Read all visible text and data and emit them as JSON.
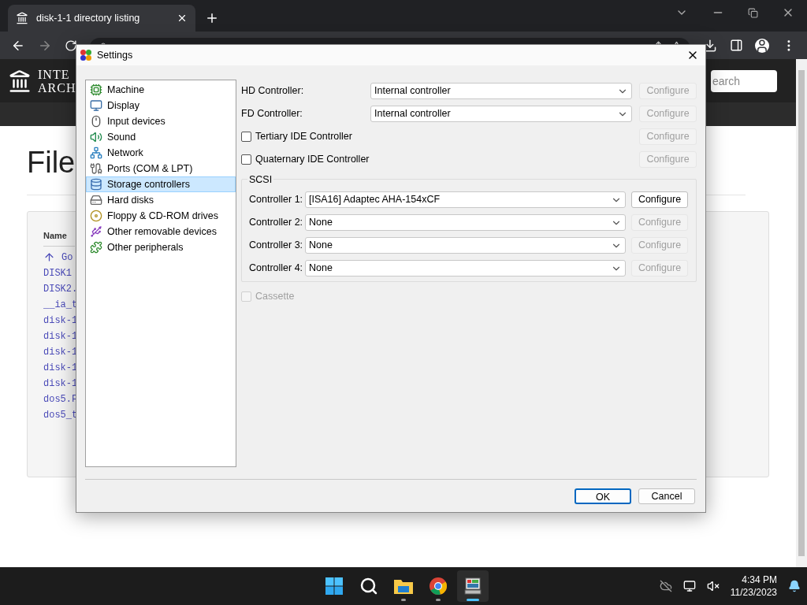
{
  "browser": {
    "tab": {
      "title": "disk-1-1 directory listing"
    }
  },
  "page": {
    "logo_lines": [
      "INTE",
      "ARCH"
    ],
    "search": {
      "placeholder": "earch"
    },
    "heading": "File",
    "table": {
      "column": "Name",
      "rows": [
        "Go",
        "DISK1",
        "DISK2.",
        "__ia_t",
        "disk-1",
        "disk-1",
        "disk-1",
        "disk-1",
        "disk-1",
        "dos5.F",
        "dos5_t"
      ]
    }
  },
  "dialog": {
    "title": "Settings",
    "categories": [
      {
        "label": "Machine",
        "selected": false
      },
      {
        "label": "Display",
        "selected": false
      },
      {
        "label": "Input devices",
        "selected": false
      },
      {
        "label": "Sound",
        "selected": false
      },
      {
        "label": "Network",
        "selected": false
      },
      {
        "label": "Ports (COM & LPT)",
        "selected": false
      },
      {
        "label": "Storage controllers",
        "selected": true
      },
      {
        "label": "Hard disks",
        "selected": false
      },
      {
        "label": "Floppy & CD-ROM drives",
        "selected": false
      },
      {
        "label": "Other removable devices",
        "selected": false
      },
      {
        "label": "Other peripherals",
        "selected": false
      }
    ],
    "controllers": [
      {
        "kind": "select",
        "label": "HD Controller:",
        "value": "Internal controller",
        "configure": "Configure",
        "configure_disabled": true
      },
      {
        "kind": "select",
        "label": "FD Controller:",
        "value": "Internal controller",
        "configure": "Configure",
        "configure_disabled": true
      },
      {
        "kind": "checkbox",
        "label": "Tertiary IDE Controller",
        "checked": false,
        "configure": "Configure",
        "configure_disabled": true
      },
      {
        "kind": "checkbox",
        "label": "Quaternary IDE Controller",
        "checked": false,
        "configure": "Configure",
        "configure_disabled": true
      }
    ],
    "scsi": {
      "title": "SCSI",
      "controllers": [
        {
          "label": "Controller 1:",
          "value": "[ISA16] Adaptec AHA-154xCF",
          "configure": "Configure",
          "configure_disabled": false
        },
        {
          "label": "Controller 2:",
          "value": "None",
          "configure": "Configure",
          "configure_disabled": true
        },
        {
          "label": "Controller 3:",
          "value": "None",
          "configure": "Configure",
          "configure_disabled": true
        },
        {
          "label": "Controller 4:",
          "value": "None",
          "configure": "Configure",
          "configure_disabled": true
        }
      ]
    },
    "cassette": {
      "label": "Cassette",
      "checked": false,
      "disabled": true
    },
    "buttons": [
      {
        "label": "OK",
        "default": true
      },
      {
        "label": "Cancel",
        "default": false
      }
    ]
  },
  "taskbar": {
    "apps": [
      {
        "kind": "start",
        "running": false,
        "active": false
      },
      {
        "kind": "search",
        "running": false,
        "active": false
      },
      {
        "kind": "files",
        "running": true,
        "active": false
      },
      {
        "kind": "browser",
        "running": true,
        "active": false
      },
      {
        "kind": "emulator",
        "running": true,
        "active": true
      }
    ],
    "clock": {
      "time": "4:34 PM",
      "date": "11/23/2023"
    }
  }
}
